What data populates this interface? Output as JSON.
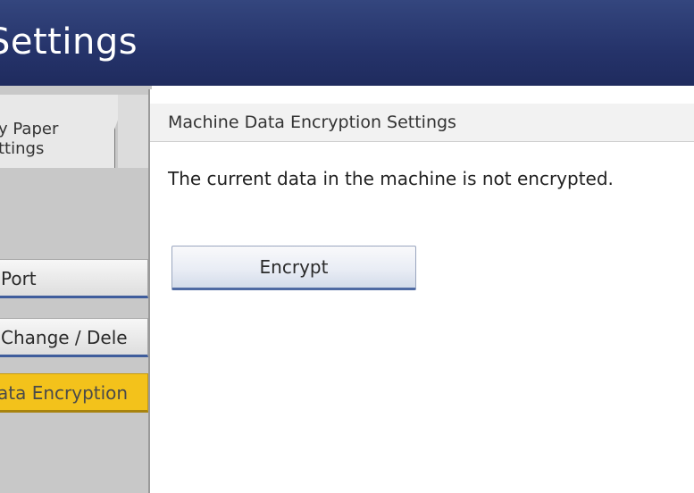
{
  "header": {
    "title": "Settings"
  },
  "left_panel": {
    "tab": {
      "label_line1": "y Paper",
      "label_line2": "ttings"
    },
    "menu_items": [
      {
        "label": "Port"
      },
      {
        "label": "Change / Dele"
      },
      {
        "label": "ata Encryption",
        "active": true
      }
    ]
  },
  "dialog": {
    "title": "Machine Data Encryption Settings",
    "message": "The current data in the machine is not encrypted.",
    "encrypt_button_label": "Encrypt"
  },
  "colors": {
    "header_bg": "#25336a",
    "active_item": "#f3c21b",
    "button_accent": "#4f6aa3"
  }
}
